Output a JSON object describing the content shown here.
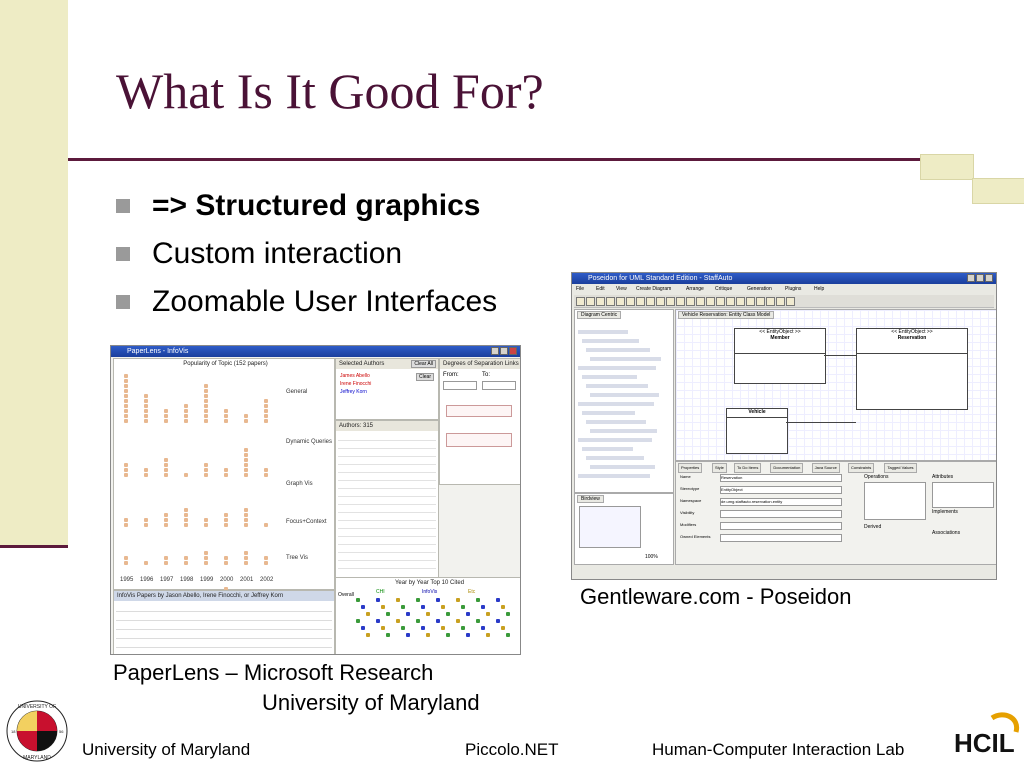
{
  "slide": {
    "title": "What Is It Good For?",
    "bullets": [
      {
        "text": "=> Structured graphics",
        "bold": true
      },
      {
        "text": "Custom interaction",
        "bold": false
      },
      {
        "text": "Zoomable User Interfaces",
        "bold": false
      }
    ]
  },
  "screenshot_left": {
    "window_title": "PaperLens - InfoVis",
    "panels": {
      "popularity": "Popularity of Topic (152 papers)",
      "selected_authors": "Selected Authors",
      "degrees": "Degrees of Separation Links",
      "authors_count": "Authors: 315",
      "year_by_year": "Year by Year Top 10 Cited",
      "bottom_list": "InfoVis Papers by Jason Abello, Irene Finocchi, or Jeffrey Korn"
    },
    "topics": [
      "General",
      "Dynamic Queries",
      "Graph Vis",
      "Focus+Context",
      "Tree Vis"
    ],
    "years": [
      "1995",
      "1996",
      "1997",
      "1998",
      "1999",
      "2000",
      "2001",
      "2002"
    ],
    "authors": [
      "James Abello",
      "Irene Finocchi",
      "Jeffrey Korn"
    ],
    "from_label": "From:",
    "to_label": "To:",
    "clear_all": "Clear All",
    "clear": "Clear",
    "papers_label": "Papers",
    "overall": "Overall",
    "legend": [
      "CHI",
      "InfoVis",
      "Etc"
    ]
  },
  "screenshot_right": {
    "window_title": "Poseidon for UML Standard Edition - StaffAuto",
    "menu": [
      "File",
      "Edit",
      "View",
      "Create Diagram",
      "Arrange",
      "Critique",
      "Generation",
      "Plugins",
      "Help"
    ],
    "diagram_tab": "Vehicle Reservation: Entity Class Model",
    "navigator_tab": "Diagram Centric",
    "classes": [
      {
        "stereotype": "<< EntityObject >>",
        "name": "Member"
      },
      {
        "stereotype": "<< EntityObject >>",
        "name": "Reservation"
      },
      {
        "stereotype": "",
        "name": "Vehicle"
      }
    ],
    "properties_tabs": [
      "Properties",
      "Style",
      "To Do Items",
      "Documentation",
      "Java Source",
      "Constraints",
      "Tagged Values"
    ],
    "fields": [
      "Name",
      "Stereotype",
      "Namespace",
      "Visibility",
      "Modifiers",
      "Owned Elements"
    ],
    "field_values": [
      "Reservation",
      "EntityObject",
      "de.umg.staffauto.reservation.entity"
    ],
    "operations_label": "Operations",
    "attributes_label": "Attributes",
    "implements_label": "Implements",
    "associations_label": "Associations",
    "derived_label": "Derived",
    "birdview": "Birdview",
    "zoom": "100%"
  },
  "captions": {
    "right": "Gentleware.com - Poseidon",
    "left_line1": "PaperLens – Microsoft Research",
    "left_line2": "University of Maryland"
  },
  "footer": {
    "left": "University of Maryland",
    "center": "Piccolo.NET",
    "right": "Human-Computer Interaction Lab"
  },
  "logos": {
    "seal": "UNIVERSITY OF MARYLAND",
    "seal_years": [
      "18",
      "56"
    ],
    "hcil": "HCIL"
  },
  "colors": {
    "title": "#4a1236",
    "rule": "#5c1a3c",
    "band": "#eeecc5",
    "bullet": "#9a9a9a"
  }
}
